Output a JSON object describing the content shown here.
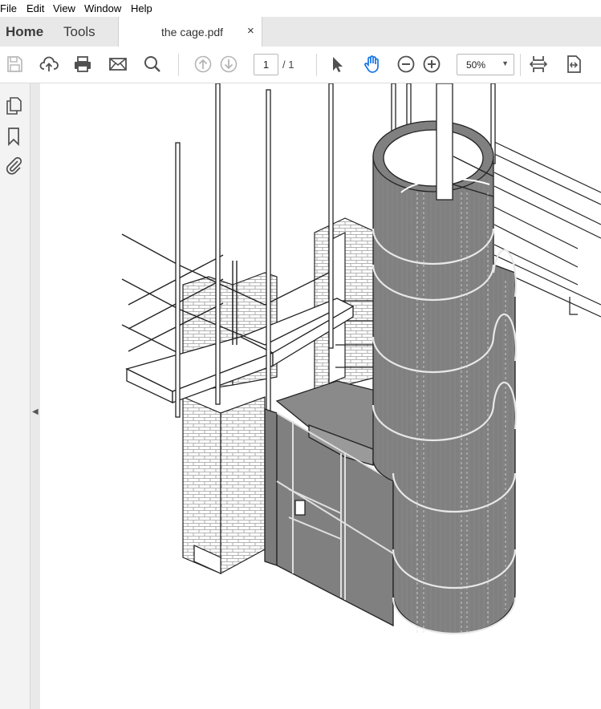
{
  "menu": {
    "file": "File",
    "edit": "Edit",
    "view": "View",
    "window": "Window",
    "help": "Help"
  },
  "tabs": {
    "home": "Home",
    "tools": "Tools",
    "document_title": "the cage.pdf",
    "close_glyph": "×"
  },
  "toolbar": {
    "current_page": "1",
    "page_total": "/ 1",
    "zoom": "50%",
    "icons": [
      "save-icon",
      "cloud-upload-icon",
      "print-icon",
      "email-icon",
      "search-icon",
      "previous-page-icon",
      "next-page-icon",
      "select-tool-icon",
      "hand-tool-icon",
      "zoom-out-icon",
      "zoom-in-icon",
      "fit-page-icon",
      "export-page-icon"
    ]
  },
  "left_panel": {
    "icons": [
      "pages-icon",
      "bookmark-icon",
      "attachment-icon"
    ]
  },
  "colors": {
    "accent_blue": "#1473e6",
    "icon_gray": "#505050",
    "panel_gray": "#808080"
  }
}
